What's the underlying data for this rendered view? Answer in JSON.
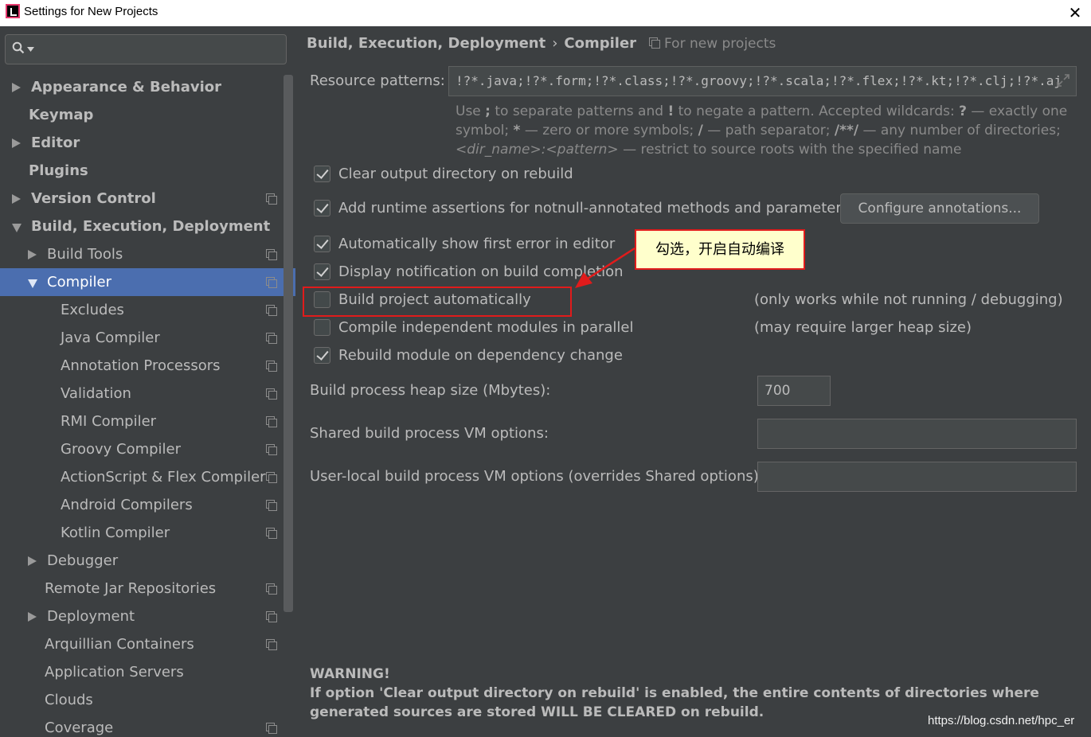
{
  "window": {
    "title": "Settings for New Projects"
  },
  "sidebar": {
    "search_placeholder": "",
    "items": [
      {
        "label": "Appearance & Behavior",
        "level": 0,
        "arrow": "right",
        "bold": true,
        "proj": false,
        "selected": false
      },
      {
        "label": "Keymap",
        "level": 0,
        "arrow": "none",
        "bold": true,
        "proj": false,
        "selected": false
      },
      {
        "label": "Editor",
        "level": 0,
        "arrow": "right",
        "bold": true,
        "proj": false,
        "selected": false
      },
      {
        "label": "Plugins",
        "level": 0,
        "arrow": "none",
        "bold": true,
        "proj": false,
        "selected": false
      },
      {
        "label": "Version Control",
        "level": 0,
        "arrow": "right",
        "bold": true,
        "proj": true,
        "selected": false
      },
      {
        "label": "Build, Execution, Deployment",
        "level": 0,
        "arrow": "down",
        "bold": true,
        "proj": false,
        "selected": false
      },
      {
        "label": "Build Tools",
        "level": 1,
        "arrow": "right",
        "bold": false,
        "proj": true,
        "selected": false
      },
      {
        "label": "Compiler",
        "level": 1,
        "arrow": "down",
        "bold": false,
        "proj": true,
        "selected": true
      },
      {
        "label": "Excludes",
        "level": 2,
        "arrow": "none",
        "bold": false,
        "proj": true,
        "selected": false
      },
      {
        "label": "Java Compiler",
        "level": 2,
        "arrow": "none",
        "bold": false,
        "proj": true,
        "selected": false
      },
      {
        "label": "Annotation Processors",
        "level": 2,
        "arrow": "none",
        "bold": false,
        "proj": true,
        "selected": false
      },
      {
        "label": "Validation",
        "level": 2,
        "arrow": "none",
        "bold": false,
        "proj": true,
        "selected": false
      },
      {
        "label": "RMI Compiler",
        "level": 2,
        "arrow": "none",
        "bold": false,
        "proj": true,
        "selected": false
      },
      {
        "label": "Groovy Compiler",
        "level": 2,
        "arrow": "none",
        "bold": false,
        "proj": true,
        "selected": false
      },
      {
        "label": "ActionScript & Flex Compiler",
        "level": 2,
        "arrow": "none",
        "bold": false,
        "proj": true,
        "selected": false
      },
      {
        "label": "Android Compilers",
        "level": 2,
        "arrow": "none",
        "bold": false,
        "proj": true,
        "selected": false
      },
      {
        "label": "Kotlin Compiler",
        "level": 2,
        "arrow": "none",
        "bold": false,
        "proj": true,
        "selected": false
      },
      {
        "label": "Debugger",
        "level": 1,
        "arrow": "right",
        "bold": false,
        "proj": false,
        "selected": false
      },
      {
        "label": "Remote Jar Repositories",
        "level": 1,
        "arrow": "none",
        "bold": false,
        "proj": true,
        "selected": false
      },
      {
        "label": "Deployment",
        "level": 1,
        "arrow": "right",
        "bold": false,
        "proj": true,
        "selected": false
      },
      {
        "label": "Arquillian Containers",
        "level": 1,
        "arrow": "none",
        "bold": false,
        "proj": true,
        "selected": false
      },
      {
        "label": "Application Servers",
        "level": 1,
        "arrow": "none",
        "bold": false,
        "proj": false,
        "selected": false
      },
      {
        "label": "Clouds",
        "level": 1,
        "arrow": "none",
        "bold": false,
        "proj": false,
        "selected": false
      },
      {
        "label": "Coverage",
        "level": 1,
        "arrow": "none",
        "bold": false,
        "proj": true,
        "selected": false
      }
    ]
  },
  "header": {
    "crumb1": "Build, Execution, Deployment",
    "crumb_sep": "›",
    "crumb2": "Compiler",
    "for_new": "For new projects"
  },
  "resource": {
    "label": "Resource patterns:",
    "value": "!?*.java;!?*.form;!?*.class;!?*.groovy;!?*.scala;!?*.flex;!?*.kt;!?*.clj;!?*.aj"
  },
  "hint": {
    "p1": "Use ",
    "semi": ";",
    "p2": " to separate patterns and ",
    "bang": "!",
    "p3": " to negate a pattern. Accepted wildcards: ",
    "q": "?",
    "p4": " — exactly one symbol; ",
    "star": "*",
    "p5": " — zero or more symbols; ",
    "slash": "/",
    "p6": " — path separator; ",
    "dstar": "/**/",
    "p7": " — any number of directories; ",
    "dir": "<dir_name>:<pattern>",
    "p8": " — restrict to source roots with the specified name"
  },
  "checks": {
    "clear_output": {
      "label": "Clear output directory on rebuild",
      "checked": true
    },
    "runtime_assert": {
      "label": "Add runtime assertions for notnull-annotated methods and parameters",
      "checked": true
    },
    "show_error": {
      "label": "Automatically show first error in editor",
      "checked": true
    },
    "notify": {
      "label": "Display notification on build completion",
      "checked": true
    },
    "build_auto": {
      "label": "Build project automatically",
      "checked": false
    },
    "parallel": {
      "label": "Compile independent modules in parallel",
      "checked": false
    },
    "rebuild_dep": {
      "label": "Rebuild module on dependency change",
      "checked": true
    }
  },
  "configure_btn": "Configure annotations...",
  "notes": {
    "build_auto": "(only works while not running / debugging)",
    "parallel": "(may require larger heap size)"
  },
  "heap": {
    "label": "Build process heap size (Mbytes):",
    "value": "700"
  },
  "shared_vm": {
    "label": "Shared build process VM options:",
    "value": ""
  },
  "user_vm": {
    "label": "User-local build process VM options (overrides Shared options):",
    "value": ""
  },
  "warning": {
    "title": "WARNING!",
    "body": "If option 'Clear output directory on rebuild' is enabled, the entire contents of directories where generated sources are stored WILL BE CLEARED on rebuild."
  },
  "annotation": {
    "callout": "勾选，开启自动编译"
  },
  "watermark": "https://blog.csdn.net/hpc_er",
  "colors": {
    "background": "#3c3f41",
    "selection": "#4b6eaf",
    "annotation_red": "#e11b1b",
    "callout_bg": "#ffffcc"
  }
}
